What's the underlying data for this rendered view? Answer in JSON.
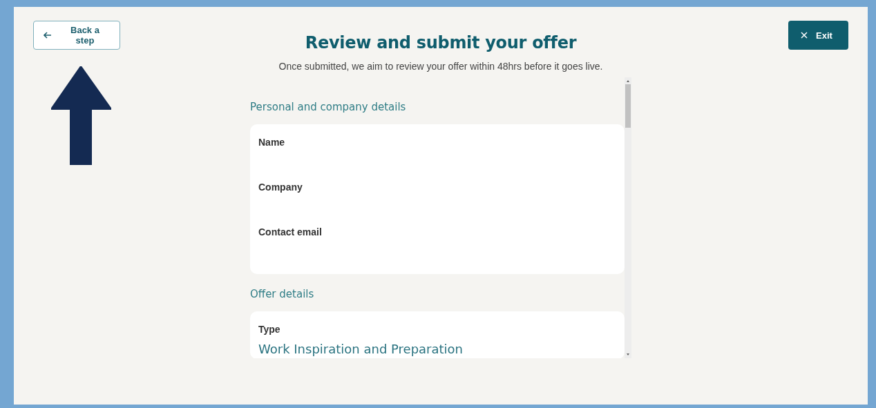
{
  "header": {
    "back_button": "Back a step",
    "exit_button": "Exit"
  },
  "title": "Review and submit your offer",
  "subtitle": "Once submitted, we aim to review your offer within 48hrs before it goes live.",
  "sections": [
    {
      "heading": "Personal and company details",
      "fields": [
        {
          "label": "Name"
        },
        {
          "label": "Company"
        },
        {
          "label": "Contact email"
        }
      ]
    },
    {
      "heading": "Offer details",
      "fields": [
        {
          "label": "Type",
          "value": "Work Inspiration and Preparation"
        }
      ]
    }
  ]
}
